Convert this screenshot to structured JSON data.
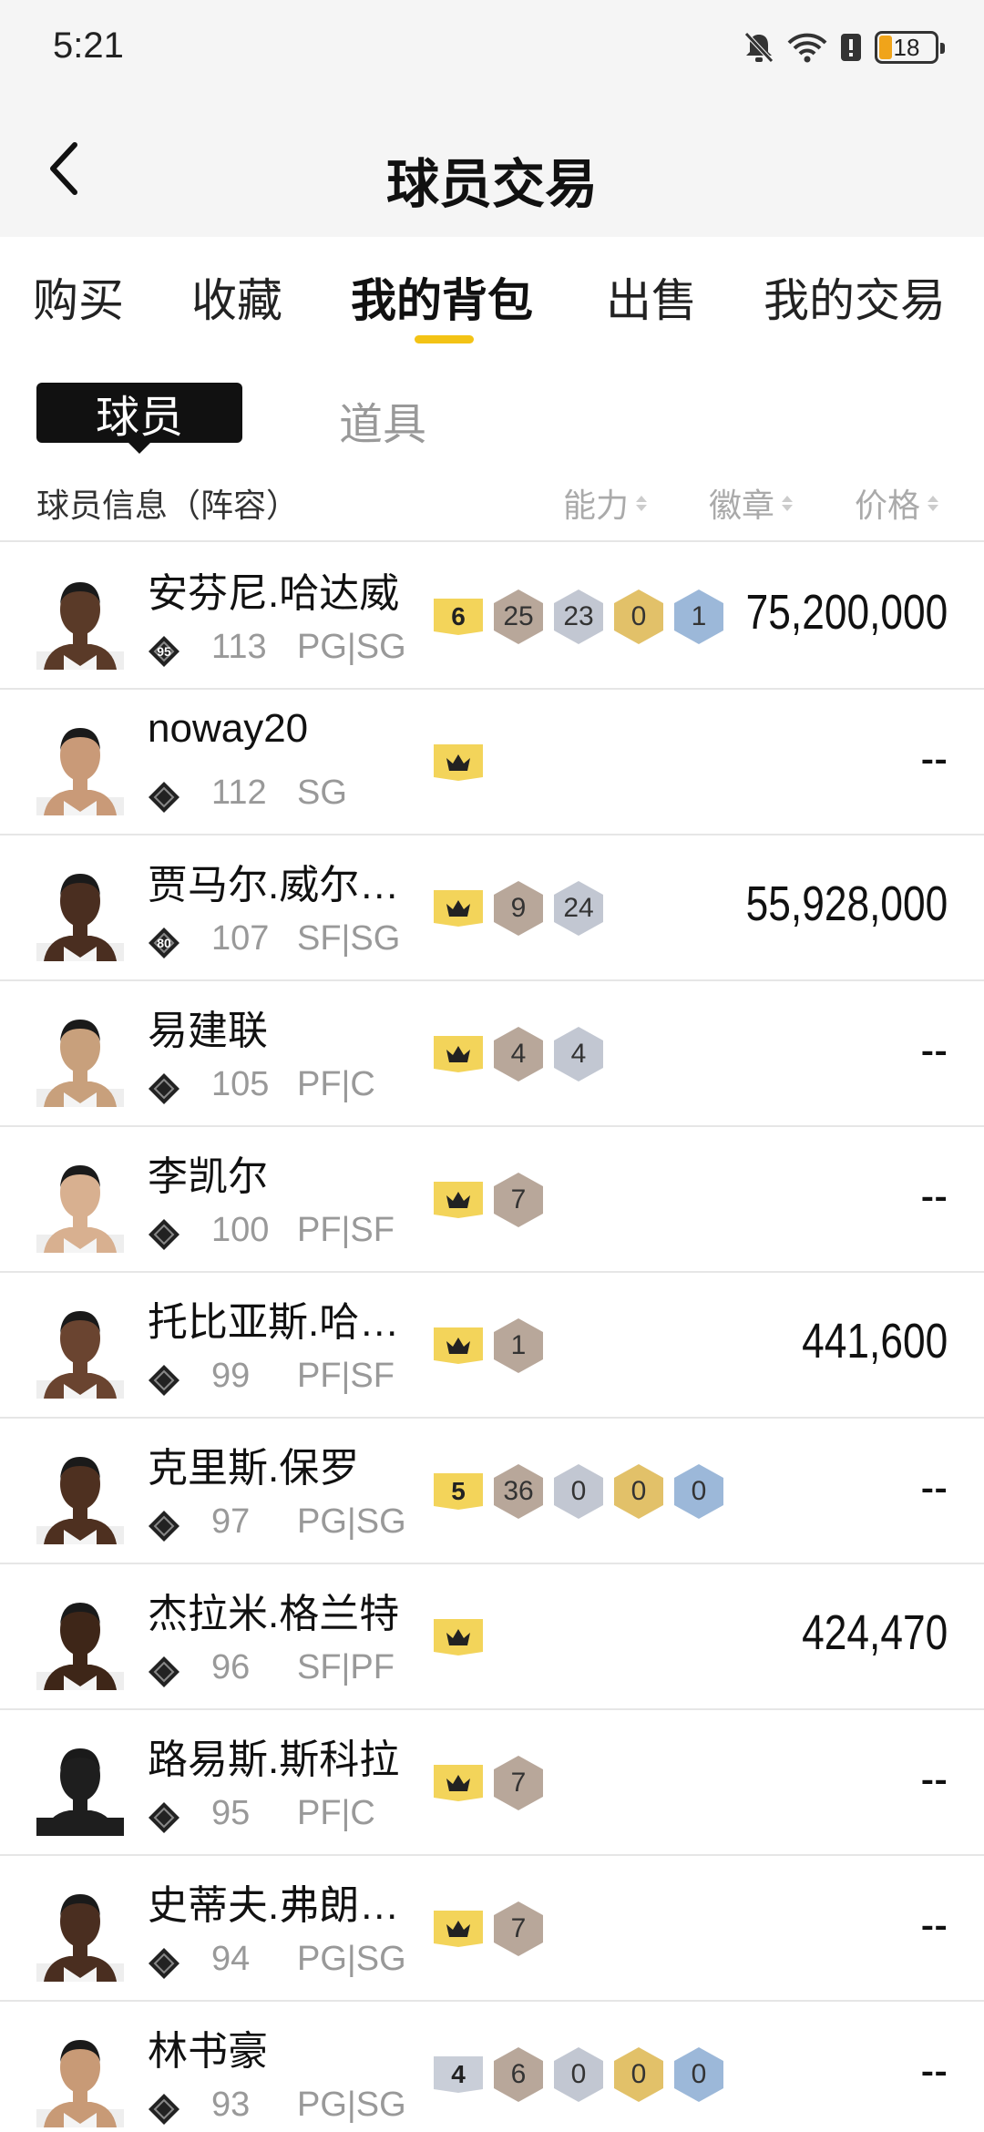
{
  "status": {
    "time": "5:21",
    "battery": "18"
  },
  "header": {
    "title": "球员交易"
  },
  "tabs": [
    "购买",
    "收藏",
    "我的背包",
    "出售",
    "我的交易"
  ],
  "active_tab": "我的背包",
  "subtabs": {
    "active": "球员",
    "other": "道具"
  },
  "columns": {
    "info": "球员信息（阵容）",
    "ability": "能力",
    "badge": "徽章",
    "price": "价格"
  },
  "players": [
    {
      "name": "安芬尼.哈达威",
      "tier": "95",
      "rating": "113",
      "pos": "PG|SG",
      "level": "6",
      "badges": [
        "25",
        "23",
        "0",
        "1"
      ],
      "badge_kinds": [
        "bronze",
        "silver",
        "gold",
        "blue"
      ],
      "price": "75,200,000"
    },
    {
      "name": "noway20",
      "tier": "",
      "rating": "112",
      "pos": "SG",
      "level": "crown",
      "badges": [],
      "badge_kinds": [],
      "price": "--"
    },
    {
      "name": "贾马尔.威尔…",
      "tier": "80",
      "rating": "107",
      "pos": "SF|SG",
      "level": "crown",
      "badges": [
        "9",
        "24"
      ],
      "badge_kinds": [
        "bronze",
        "silver"
      ],
      "price": "55,928,000"
    },
    {
      "name": "易建联",
      "tier": "",
      "rating": "105",
      "pos": "PF|C",
      "level": "crown",
      "badges": [
        "4",
        "4"
      ],
      "badge_kinds": [
        "bronze",
        "silver"
      ],
      "price": "--"
    },
    {
      "name": "李凯尔",
      "tier": "",
      "rating": "100",
      "pos": "PF|SF",
      "level": "crown",
      "badges": [
        "7"
      ],
      "badge_kinds": [
        "bronze"
      ],
      "price": "--"
    },
    {
      "name": "托比亚斯.哈…",
      "tier": "",
      "rating": "99",
      "pos": "PF|SF",
      "level": "crown",
      "badges": [
        "1"
      ],
      "badge_kinds": [
        "bronze"
      ],
      "price": "441,600"
    },
    {
      "name": "克里斯.保罗",
      "tier": "",
      "rating": "97",
      "pos": "PG|SG",
      "level": "5",
      "badges": [
        "36",
        "0",
        "0",
        "0"
      ],
      "badge_kinds": [
        "bronze",
        "silver",
        "gold",
        "blue"
      ],
      "price": "--"
    },
    {
      "name": "杰拉米.格兰特",
      "tier": "",
      "rating": "96",
      "pos": "SF|PF",
      "level": "crown",
      "badges": [],
      "badge_kinds": [],
      "price": "424,470"
    },
    {
      "name": "路易斯.斯科拉",
      "tier": "",
      "rating": "95",
      "pos": "PF|C",
      "level": "crown",
      "badges": [
        "7"
      ],
      "badge_kinds": [
        "bronze"
      ],
      "price": "--"
    },
    {
      "name": "史蒂夫.弗朗…",
      "tier": "",
      "rating": "94",
      "pos": "PG|SG",
      "level": "crown",
      "badges": [
        "7"
      ],
      "badge_kinds": [
        "bronze"
      ],
      "price": "--"
    },
    {
      "name": "林书豪",
      "tier": "",
      "rating": "93",
      "pos": "PG|SG",
      "level": "4",
      "badges": [
        "6",
        "0",
        "0",
        "0"
      ],
      "badge_kinds": [
        "bronze",
        "silver",
        "gold",
        "blue"
      ],
      "price": "--"
    }
  ],
  "colors": {
    "accent": "#f3c315",
    "level_gold": "#f3d45a",
    "bronze": "#b8a79a",
    "silver": "#c2c7d2",
    "gold": "#e2c169",
    "blue": "#9cb8d9"
  },
  "icons": {
    "back": "chevron-left-icon",
    "mute": "bell-off-icon",
    "wifi": "wifi-icon",
    "alert": "alert-icon",
    "battery": "battery-icon",
    "crown": "crown-icon",
    "tier": "diamond-tier-icon",
    "sort": "sort-arrows-icon"
  }
}
